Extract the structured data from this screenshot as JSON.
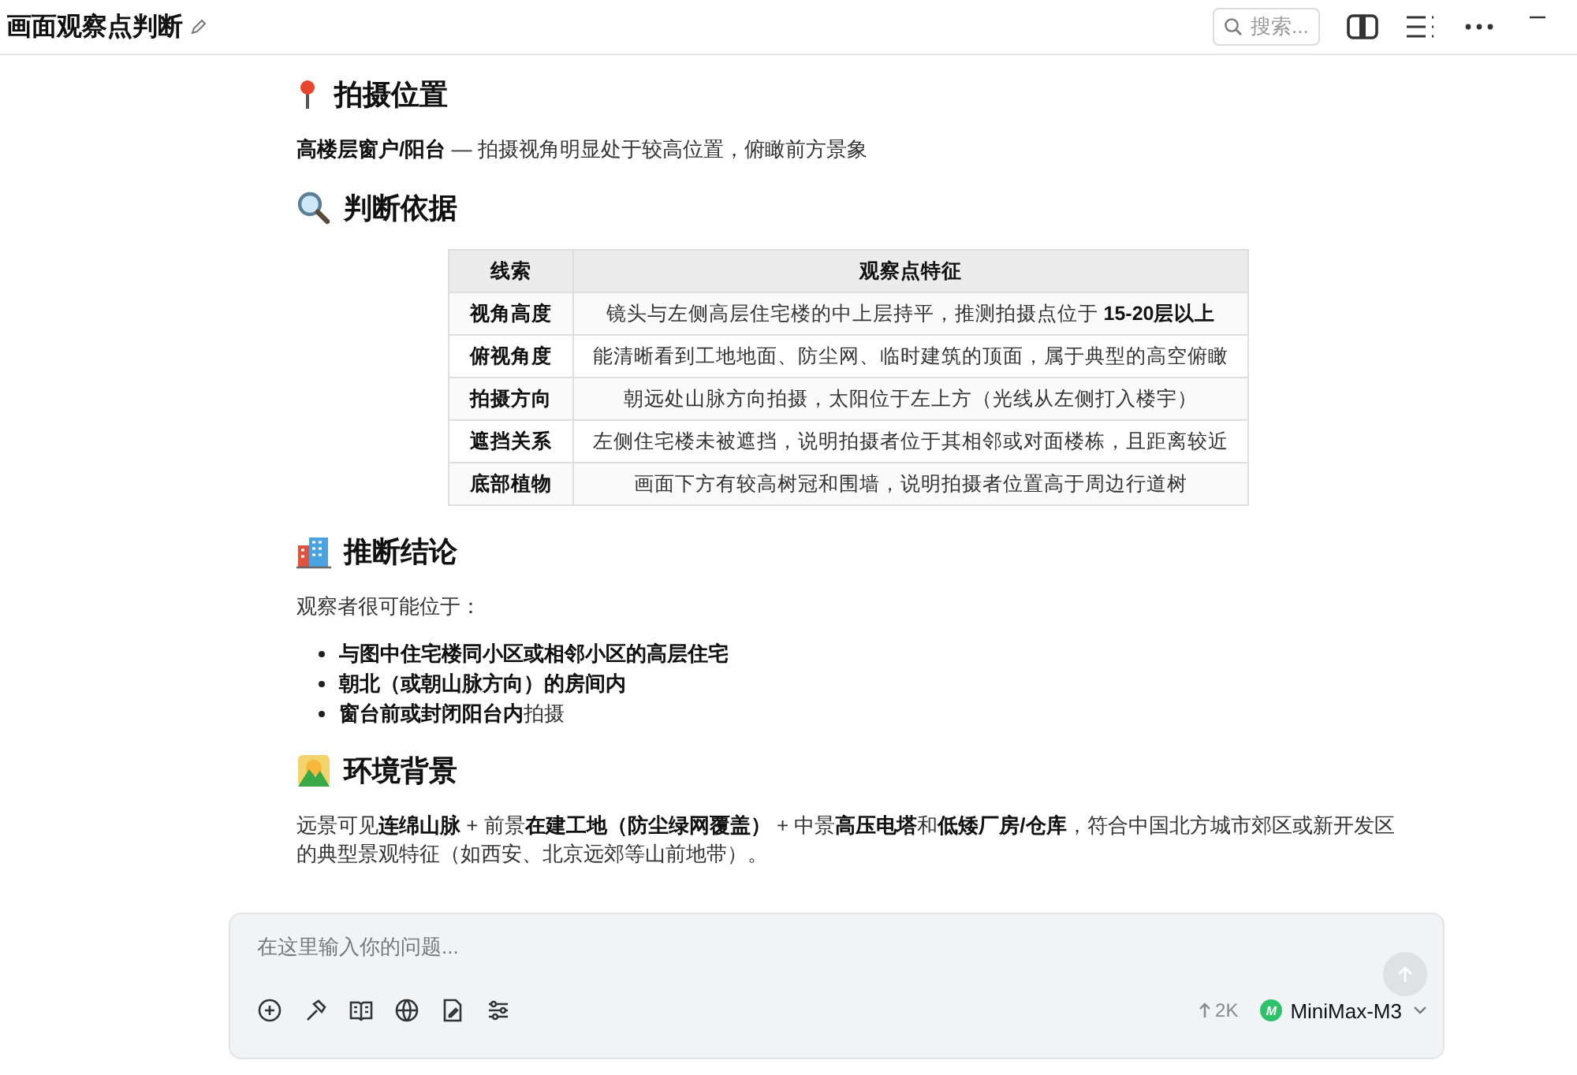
{
  "header": {
    "title": "画面观察点判断",
    "search_placeholder": "搜索..."
  },
  "location": {
    "heading": "拍摄位置",
    "text": "**高楼层窗户/阳台** — 拍摄视角明显处于较高位置，俯瞰前方景象"
  },
  "evidence": {
    "heading": "判断依据",
    "table": {
      "columns": [
        "线索",
        "观察点特征"
      ],
      "rows": [
        [
          "视角高度",
          "镜头与左侧高层住宅楼的中上层持平，推测拍摄点位于 **15-20层以上**"
        ],
        [
          "俯视角度",
          "能清晰看到工地地面、防尘网、临时建筑的顶面，属于典型的高空俯瞰"
        ],
        [
          "拍摄方向",
          "朝远处山脉方向拍摄，太阳位于左上方（光线从左侧打入楼宇）"
        ],
        [
          "遮挡关系",
          "左侧住宅楼未被遮挡，说明拍摄者位于其相邻或对面楼栋，且距离较近"
        ],
        [
          "底部植物",
          "画面下方有较高树冠和围墙，说明拍摄者位置高于周边行道树"
        ]
      ]
    }
  },
  "conclusion": {
    "heading": "推断结论",
    "intro": "观察者很可能位于：",
    "bullets": [
      "**与图中住宅楼同小区或相邻小区的高层住宅**",
      "**朝北（或朝山脉方向）的房间内**",
      "**窗台前或封闭阳台内**拍摄"
    ]
  },
  "environment": {
    "heading": "环境背景",
    "text": "远景可见**连绵山脉** + 前景**在建工地（防尘绿网覆盖）** + 中景**高压电塔**和**低矮厂房/仓库**，符合中国北方城市郊区或新开发区的典型景观特征（如西安、北京远郊等山前地带）。"
  },
  "composer": {
    "placeholder": "在这里输入你的问题...",
    "token_count": "2K",
    "model": "MiniMax-M3",
    "model_badge": "M"
  }
}
